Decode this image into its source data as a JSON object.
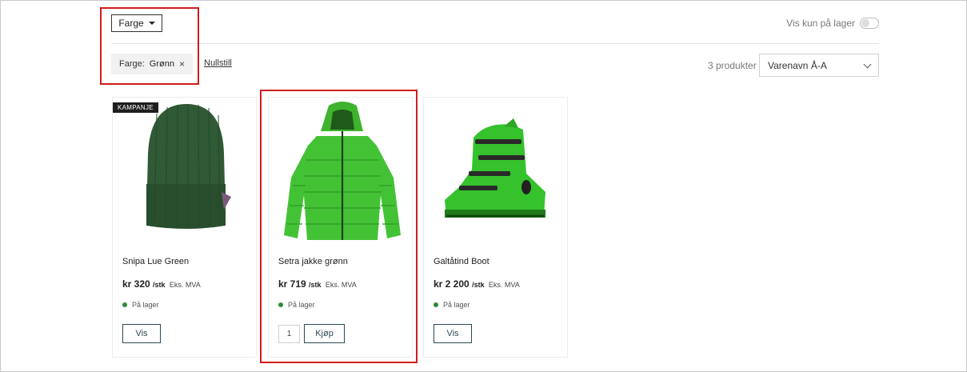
{
  "filters": {
    "color_button_label": "Farge",
    "stock_toggle_label": "Vis kun på lager",
    "active_chip": {
      "label": "Farge:",
      "value": "Grønn",
      "remove": "×"
    },
    "reset_label": "Nullstill"
  },
  "results": {
    "count_label": "3 produkter",
    "sort_selected": "Varenavn Å-A"
  },
  "products": [
    {
      "badge": "KAMPANJE",
      "name": "Snipa Lue Green",
      "price": "kr 320",
      "unit": "/stk",
      "vat": "Eks. MVA",
      "stock": "På lager",
      "action": "Vis",
      "image": "green-beanie"
    },
    {
      "name": "Setra jakke grønn",
      "price": "kr 719",
      "unit": "/stk",
      "vat": "Eks. MVA",
      "stock": "På lager",
      "quantity": "1",
      "action": "Kjøp",
      "image": "green-puffer-jacket"
    },
    {
      "name": "Galtåtind Boot",
      "price": "kr 2 200",
      "unit": "/stk",
      "vat": "Eks. MVA",
      "stock": "På lager",
      "action": "Vis",
      "image": "green-ski-boot"
    }
  ],
  "colors": {
    "stock_dot": "#2c8a3c",
    "highlight": "#d01c1c",
    "button_border": "#2e4a54"
  }
}
